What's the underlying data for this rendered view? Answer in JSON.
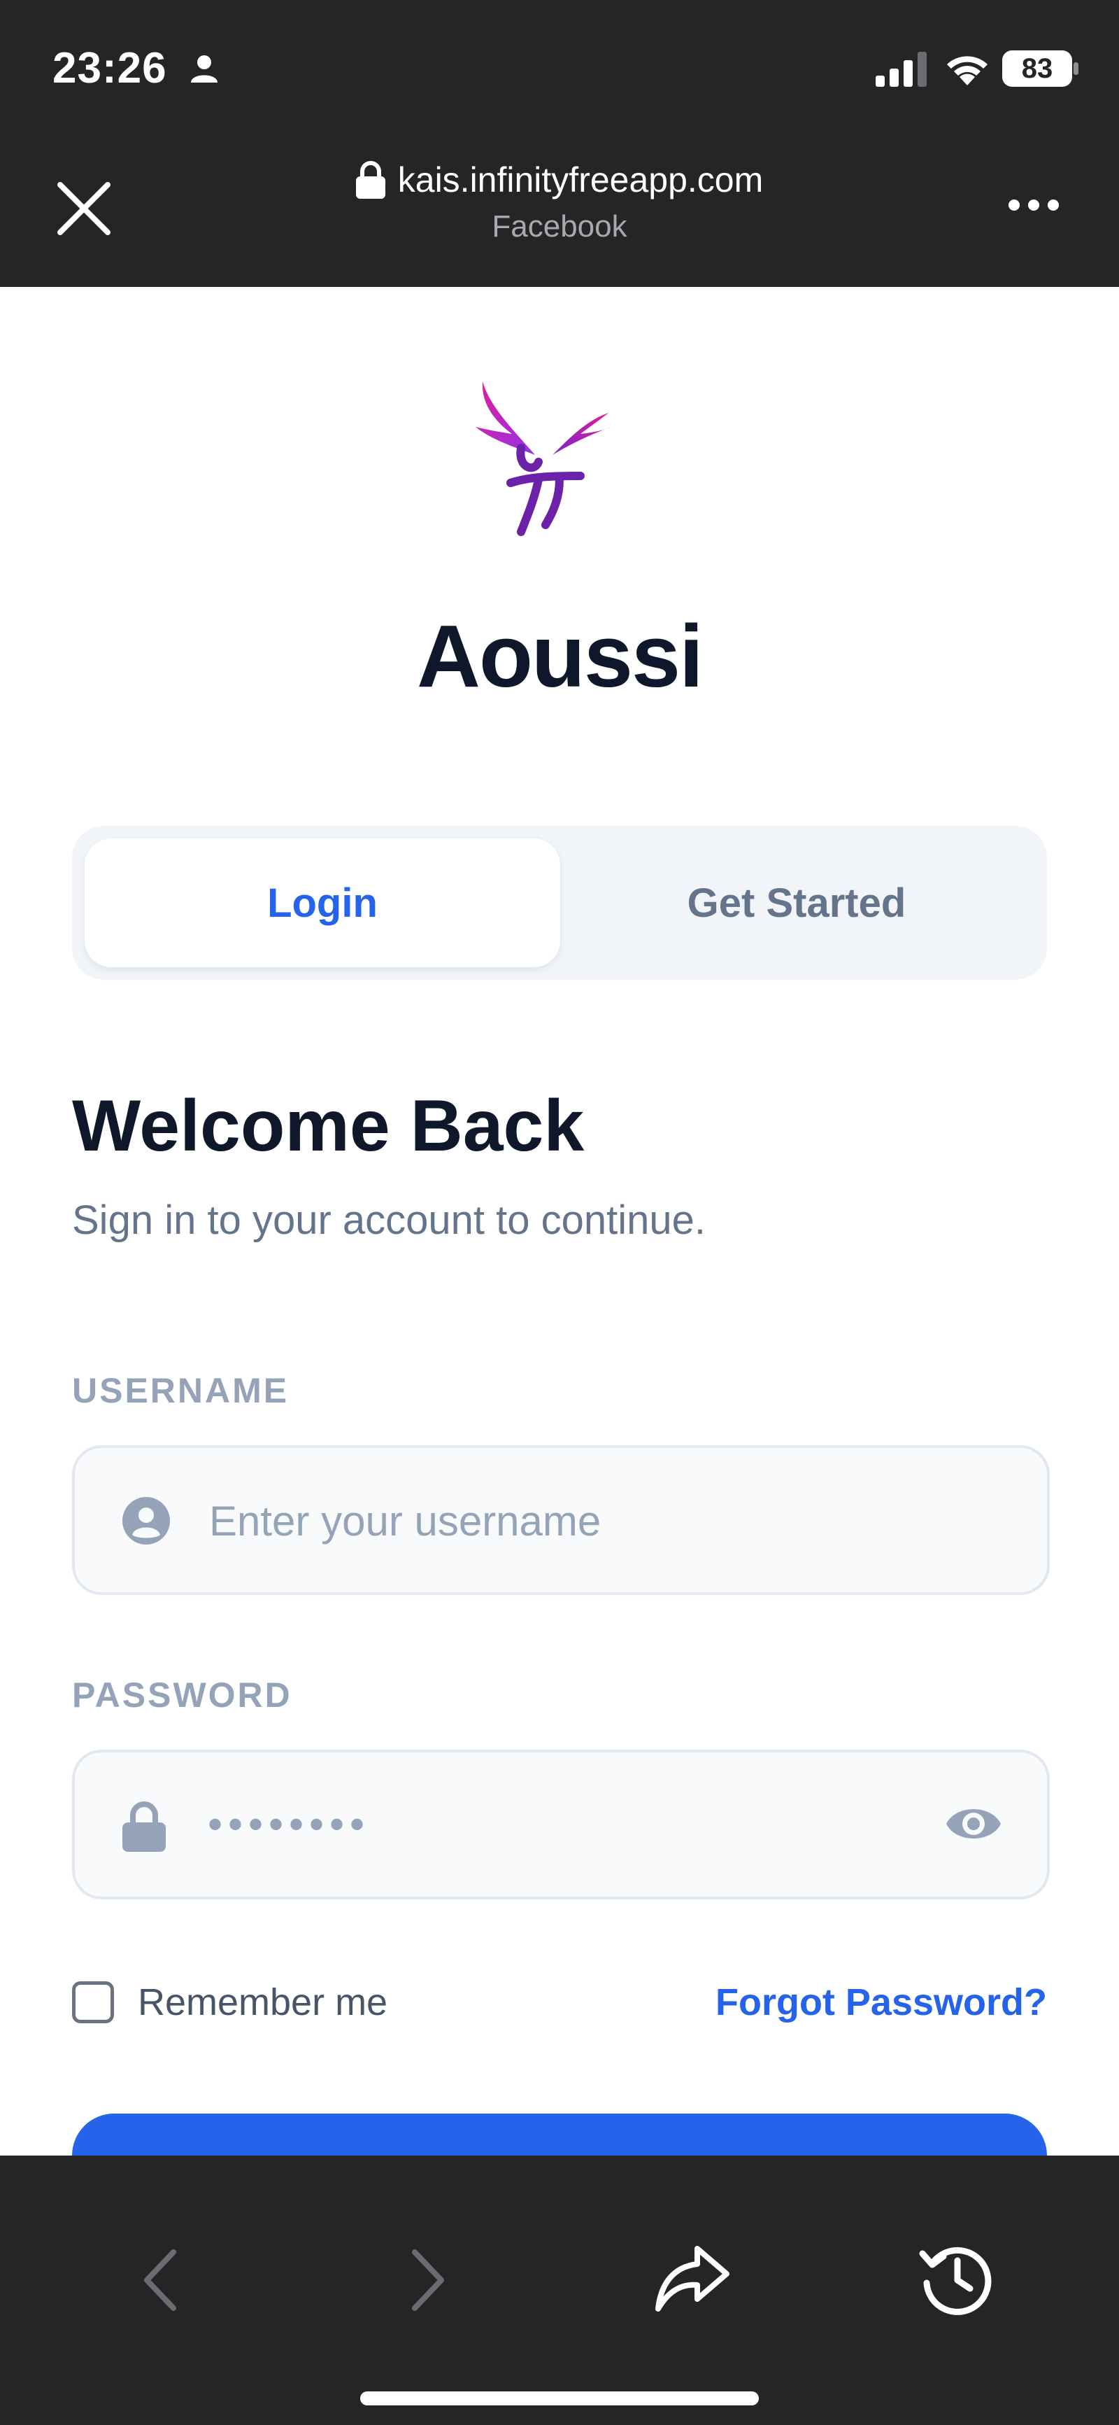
{
  "status_bar": {
    "time": "23:26",
    "battery": "83"
  },
  "browser": {
    "url": "kais.infinityfreeapp.com",
    "source": "Facebook"
  },
  "brand": {
    "name": "Aoussi"
  },
  "tabs": [
    {
      "label": "Login",
      "active": true
    },
    {
      "label": "Get Started",
      "active": false
    }
  ],
  "auth": {
    "title": "Welcome Back",
    "subtitle": "Sign in to your account to continue.",
    "username_label": "USERNAME",
    "username_placeholder": "Enter your username",
    "password_label": "PASSWORD",
    "password_value": "••••••••",
    "remember_label": "Remember me",
    "forgot_label": "Forgot Password?"
  },
  "colors": {
    "primary": "#2563eb",
    "dark_chrome": "#242527",
    "heading": "#0f172a"
  }
}
